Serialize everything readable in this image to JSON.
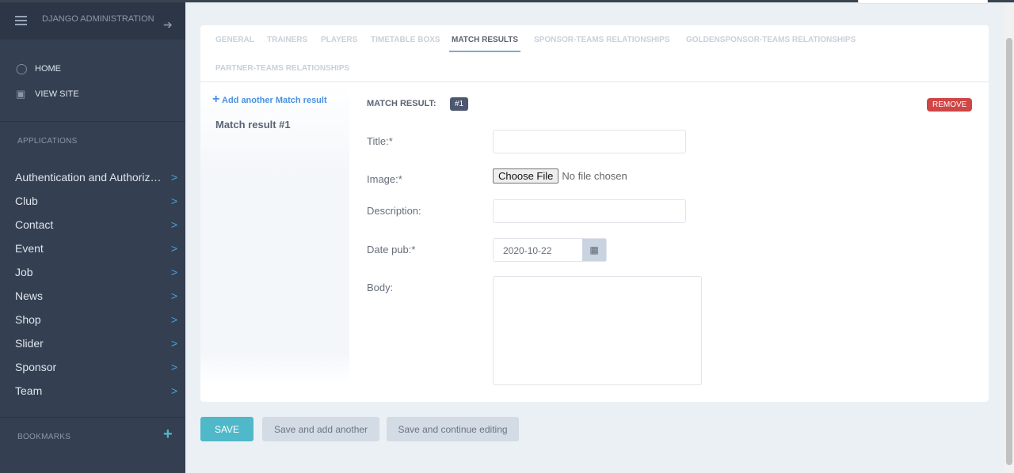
{
  "sidebar": {
    "title": "DJANGO ADMINISTRATION",
    "home": "HOME",
    "view_site": "VIEW SITE",
    "applications": "APPLICATIONS",
    "bookmarks": "BOOKMARKS",
    "apps": [
      "Authentication and Authoriz…",
      "Club",
      "Contact",
      "Event",
      "Job",
      "News",
      "Shop",
      "Slider",
      "Sponsor",
      "Team"
    ]
  },
  "tabs": [
    "GENERAL",
    "TRAINERS",
    "PLAYERS",
    "TIMETABLE BOXS",
    "MATCH RESULTS",
    "SPONSOR-TEAMS RELATIONSHIPS",
    "GOLDENSPONSOR-TEAMS RELATIONSHIPS",
    "PARTNER-TEAMS RELATIONSHIPS"
  ],
  "inline": {
    "add_link": "Add another Match result",
    "item": "Match result #1",
    "header": "MATCH RESULT:",
    "badge": "#1",
    "remove": "REMOVE"
  },
  "form": {
    "title_label": "Title:*",
    "image_label": "Image:*",
    "choose_file": "Choose File",
    "no_file": "No file chosen",
    "description_label": "Description:",
    "date_label": "Date pub:*",
    "date_value": "2020-10-22",
    "body_label": "Body:"
  },
  "buttons": {
    "save": "SAVE",
    "save_add": "Save and add another",
    "save_continue": "Save and continue editing"
  }
}
